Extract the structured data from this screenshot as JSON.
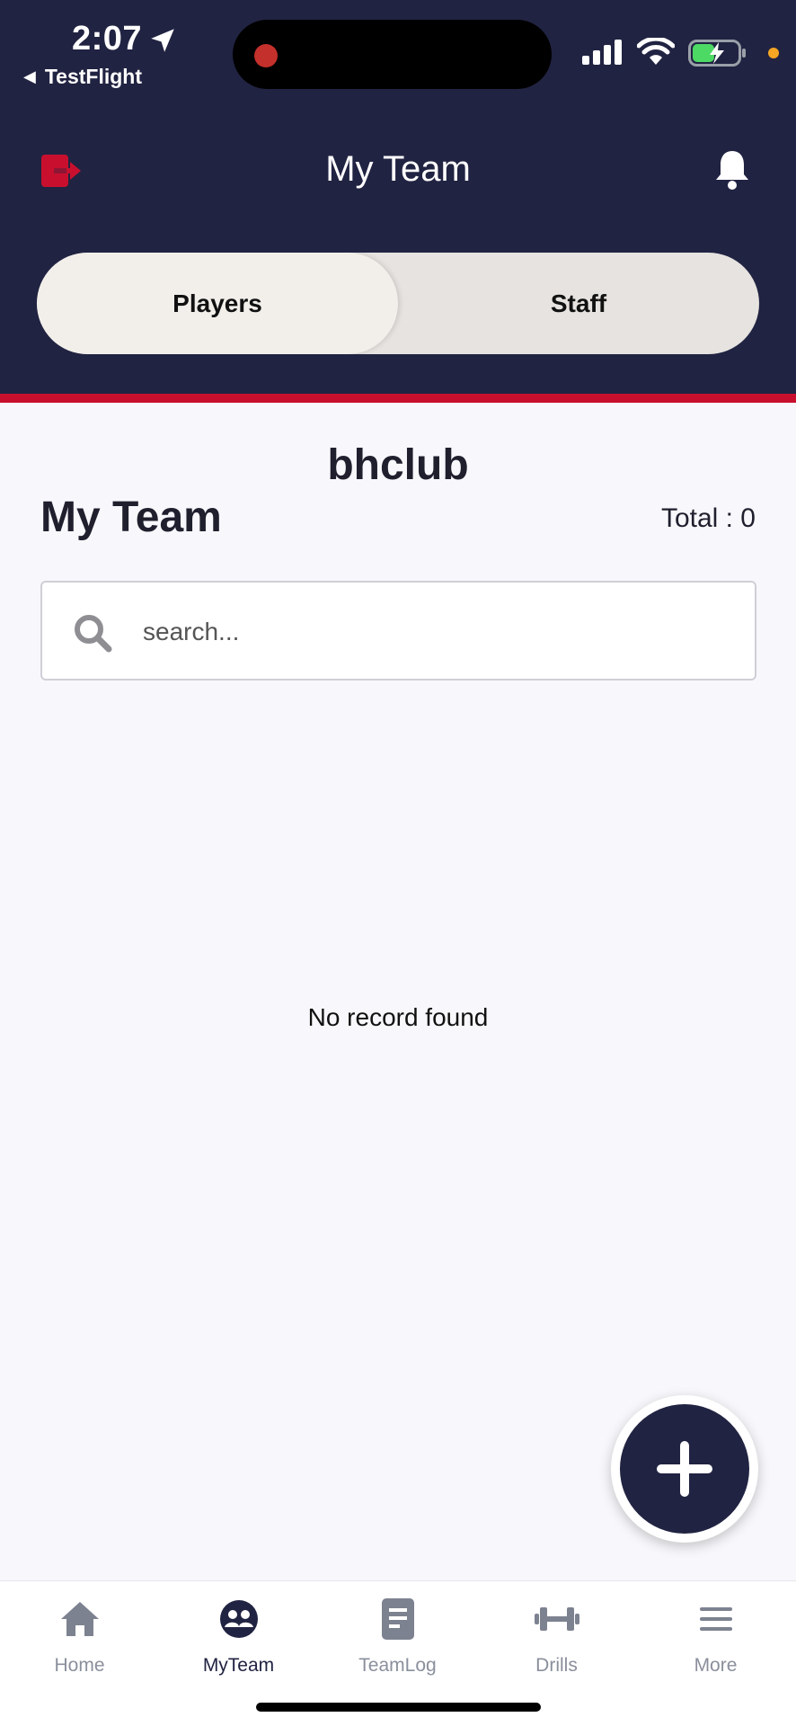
{
  "status_bar": {
    "time": "2:07",
    "back_app": "TestFlight"
  },
  "header": {
    "title": "My Team",
    "segments": [
      {
        "label": "Players",
        "selected": true
      },
      {
        "label": "Staff",
        "selected": false
      }
    ]
  },
  "content": {
    "club_name": "bhclub",
    "title": "My Team",
    "total": "Total : 0",
    "search_placeholder": "search...",
    "empty_message": "No record found"
  },
  "tabbar": {
    "items": [
      {
        "label": "Home",
        "icon": "home-icon",
        "active": false
      },
      {
        "label": "MyTeam",
        "icon": "team-icon",
        "active": true
      },
      {
        "label": "TeamLog",
        "icon": "document-icon",
        "active": false
      },
      {
        "label": "Drills",
        "icon": "dumbbell-icon",
        "active": false
      },
      {
        "label": "More",
        "icon": "menu-icon",
        "active": false
      }
    ]
  },
  "colors": {
    "header_bg": "#212342",
    "accent_red": "#c8102e",
    "tab_inactive": "#8a8f9c"
  }
}
